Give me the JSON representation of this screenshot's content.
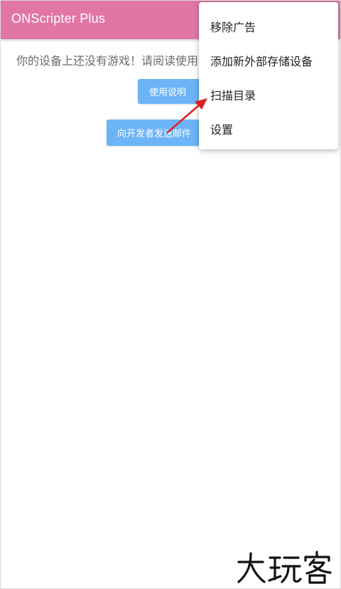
{
  "app": {
    "title": "ONScripter Plus"
  },
  "main": {
    "message": "你的设备上还没有游戏！请阅读使用说明",
    "manual_button": "使用说明",
    "email_button": "向开发者发送邮件"
  },
  "menu": {
    "items": [
      {
        "label": "移除广告"
      },
      {
        "label": "添加新外部存储设备"
      },
      {
        "label": "扫描目录"
      },
      {
        "label": "设置"
      }
    ]
  },
  "colors": {
    "appbar": "#e176a4",
    "button": "#6db4f7",
    "annotation_arrow": "#e02020"
  },
  "watermark": {
    "text": "大玩客"
  }
}
